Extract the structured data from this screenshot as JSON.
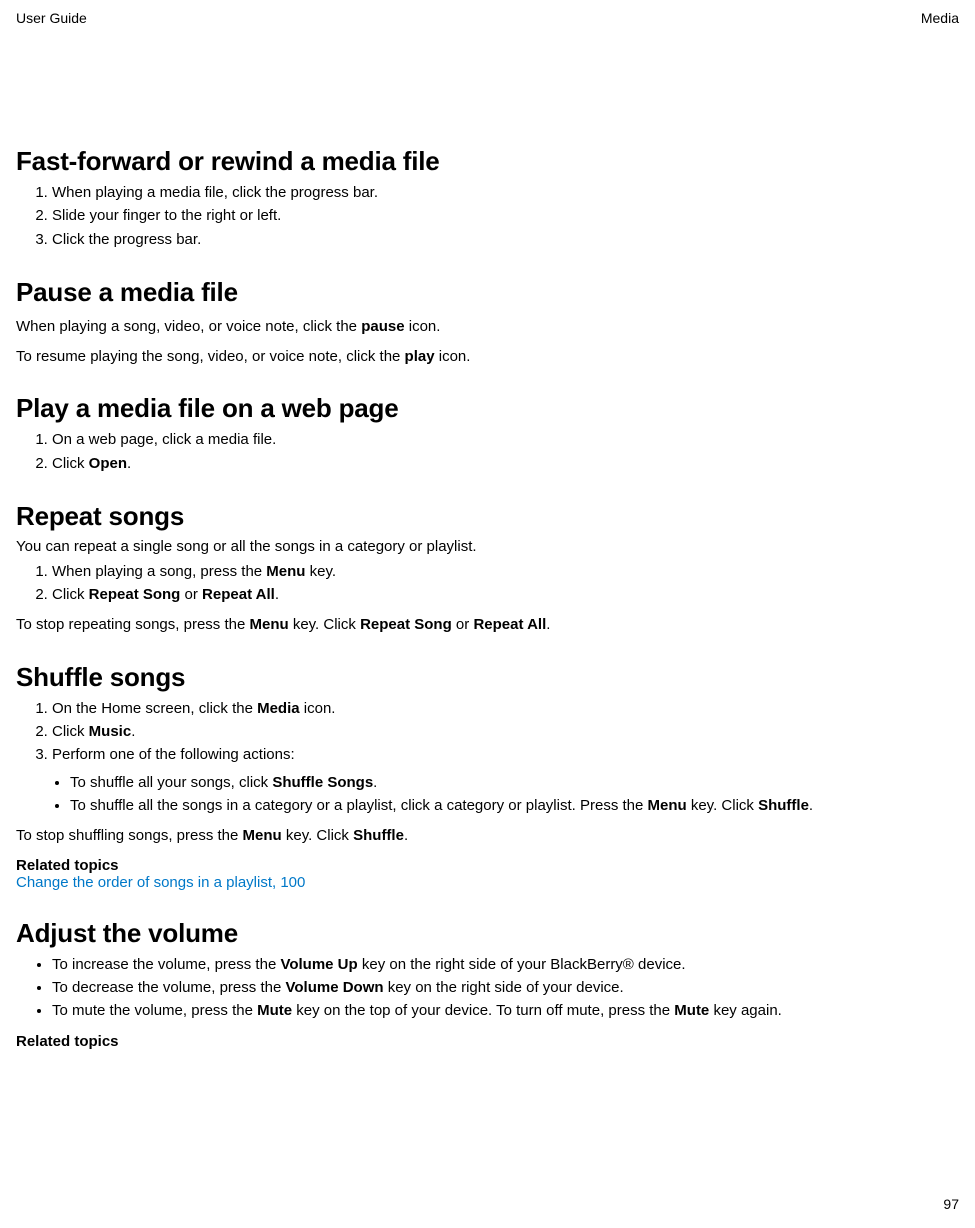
{
  "header": {
    "left": "User Guide",
    "right": "Media"
  },
  "page_number": "97",
  "sections": {
    "fastforward": {
      "title": "Fast-forward or rewind a media file",
      "steps": [
        "When playing a media file, click the progress bar.",
        "Slide your finger to the right or left.",
        "Click the progress bar."
      ]
    },
    "pause": {
      "title": "Pause a media file",
      "p1a": "When playing a song, video, or voice note, click the ",
      "p1b": "pause",
      "p1c": " icon.",
      "p2a": "To resume playing the song, video, or voice note, click the ",
      "p2b": "play",
      "p2c": " icon."
    },
    "webplay": {
      "title": "Play a media file on a web page",
      "step1": "On a web page, click a media file.",
      "step2a": "Click ",
      "step2b": "Open",
      "step2c": "."
    },
    "repeat": {
      "title": "Repeat songs",
      "intro": "You can repeat a single song or all the songs in a category or playlist.",
      "step1a": "When playing a song, press the ",
      "step1b": "Menu",
      "step1c": " key.",
      "step2a": "Click ",
      "step2b": "Repeat Song",
      "step2c": " or ",
      "step2d": "Repeat All",
      "step2e": ".",
      "p_after_a": "To stop repeating songs, press the ",
      "p_after_b": "Menu",
      "p_after_c": " key. Click ",
      "p_after_d": "Repeat Song",
      "p_after_e": " or ",
      "p_after_f": "Repeat All",
      "p_after_g": "."
    },
    "shuffle": {
      "title": "Shuffle songs",
      "step1a": "On the Home screen, click the ",
      "step1b": "Media",
      "step1c": " icon.",
      "step2a": "Click ",
      "step2b": "Music",
      "step2c": ".",
      "step3": "Perform one of the following actions:",
      "sub1a": "To shuffle all your songs, click ",
      "sub1b": "Shuffle Songs",
      "sub1c": ".",
      "sub2a": "To shuffle all the songs in a category or a playlist, click a category or playlist. Press the ",
      "sub2b": "Menu",
      "sub2c": " key. Click ",
      "sub2d": "Shuffle",
      "sub2e": ".",
      "p_after_a": "To stop shuffling songs, press the ",
      "p_after_b": "Menu",
      "p_after_c": " key. Click ",
      "p_after_d": "Shuffle",
      "p_after_e": ".",
      "related_hd": "Related topics",
      "related_link": "Change the order of songs in a playlist, 100"
    },
    "volume": {
      "title": "Adjust the volume",
      "b1a": "To increase the volume, press the ",
      "b1b": "Volume Up",
      "b1c": " key on the right side of your BlackBerry® device.",
      "b2a": "To decrease the volume, press the ",
      "b2b": "Volume Down",
      "b2c": " key on the right side of your device.",
      "b3a": "To mute the volume, press the ",
      "b3b": "Mute",
      "b3c": " key on the top of your device. To turn off mute, press the ",
      "b3d": "Mute",
      "b3e": " key again.",
      "related_hd": "Related topics"
    }
  }
}
